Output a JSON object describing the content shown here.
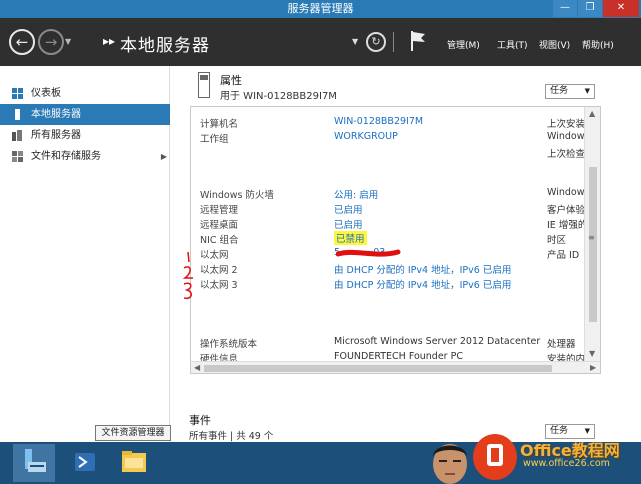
{
  "window": {
    "title": "服务器管理器",
    "btn_min": "—",
    "btn_max": "❐",
    "btn_close": "✕"
  },
  "header": {
    "title": "本地服务器",
    "chevrons": "▸▸",
    "menus": [
      {
        "label": "管理(M)"
      },
      {
        "label": "工具(T)"
      },
      {
        "label": "视图(V)"
      },
      {
        "label": "帮助(H)"
      }
    ]
  },
  "sidebar": {
    "items": [
      {
        "label": "仪表板",
        "icon": "dashboard-icon"
      },
      {
        "label": "本地服务器",
        "icon": "server-icon",
        "active": true
      },
      {
        "label": "所有服务器",
        "icon": "servers-icon"
      },
      {
        "label": "文件和存储服务",
        "icon": "storage-icon",
        "has_arrow": true
      }
    ]
  },
  "properties": {
    "title": "属性",
    "subtitle": "用于 WIN-0128BB29I7M",
    "tasks_label": "任务",
    "rows": [
      {
        "label": "计算机名",
        "value": "WIN-0128BB29I7M",
        "link": true,
        "right": "上次安装"
      },
      {
        "label": "工作组",
        "value": "WORKGROUP",
        "link": true,
        "right": "Window"
      },
      {
        "label": "",
        "value": "",
        "link": false,
        "right": "上次检查"
      },
      {
        "label": "Windows 防火墙",
        "value": "公用: 启用",
        "link": true,
        "right": "Window"
      },
      {
        "label": "远程管理",
        "value": "已启用",
        "link": true,
        "right": "客户体验"
      },
      {
        "label": "远程桌面",
        "value": "已启用",
        "link": true,
        "right": "IE 增强的"
      },
      {
        "label": "NIC 组合",
        "value": "已禁用",
        "link": true,
        "right": "时区",
        "highlight": true
      },
      {
        "label": "以太网",
        "value": "5···········03",
        "link": true,
        "right": "产品 ID"
      },
      {
        "label": "以太网 2",
        "value": "由 DHCP 分配的 IPv4 地址，IPv6 已启用",
        "link": true,
        "right": ""
      },
      {
        "label": "以太网 3",
        "value": "由 DHCP 分配的 IPv4 地址，IPv6 已启用",
        "link": true,
        "right": ""
      },
      {
        "label": "操作系统版本",
        "value": "Microsoft Windows Server 2012 Datacenter",
        "link": false,
        "right": "处理器"
      },
      {
        "label": "硬件信息",
        "value": "FOUNDERTECH Founder PC",
        "link": false,
        "right": "安装的内"
      }
    ]
  },
  "events": {
    "title": "事件",
    "subtitle": "所有事件 | 共 49 个",
    "tasks_label": "任务"
  },
  "taskbar": {
    "tooltip": "文件资源管理器"
  },
  "watermark": {
    "line1": "Office教程网",
    "line2": "www.office26.com"
  },
  "colors": {
    "accent": "#2a7ab5",
    "header": "#2f2f2f",
    "link": "#1a6fc2",
    "taskbar": "#1c4f7a"
  }
}
